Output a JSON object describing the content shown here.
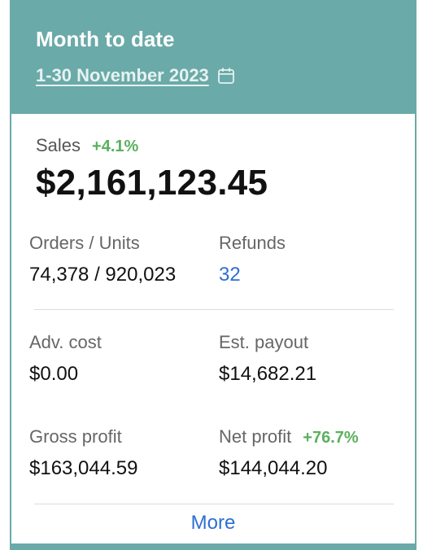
{
  "header": {
    "title": "Month to date",
    "date_range": "1-30 November 2023",
    "icon": "calendar-icon"
  },
  "sales": {
    "label": "Sales",
    "change": "+4.1%",
    "value": "$2,161,123.45"
  },
  "metrics": {
    "orders_units": {
      "label": "Orders / Units",
      "value": "74,378 / 920,023"
    },
    "refunds": {
      "label": "Refunds",
      "value": "32"
    },
    "adv_cost": {
      "label": "Adv. cost",
      "value": "$0.00"
    },
    "est_payout": {
      "label": "Est. payout",
      "value": "$14,682.21"
    },
    "gross_profit": {
      "label": "Gross profit",
      "value": "$163,044.59"
    },
    "net_profit": {
      "label": "Net profit",
      "change": "+76.7%",
      "value": "$144,044.20"
    }
  },
  "footer": {
    "more_label": "More"
  },
  "colors": {
    "header_bg": "#6aaaa8",
    "positive_change": "#5ab05e",
    "link": "#2d6fd2"
  }
}
